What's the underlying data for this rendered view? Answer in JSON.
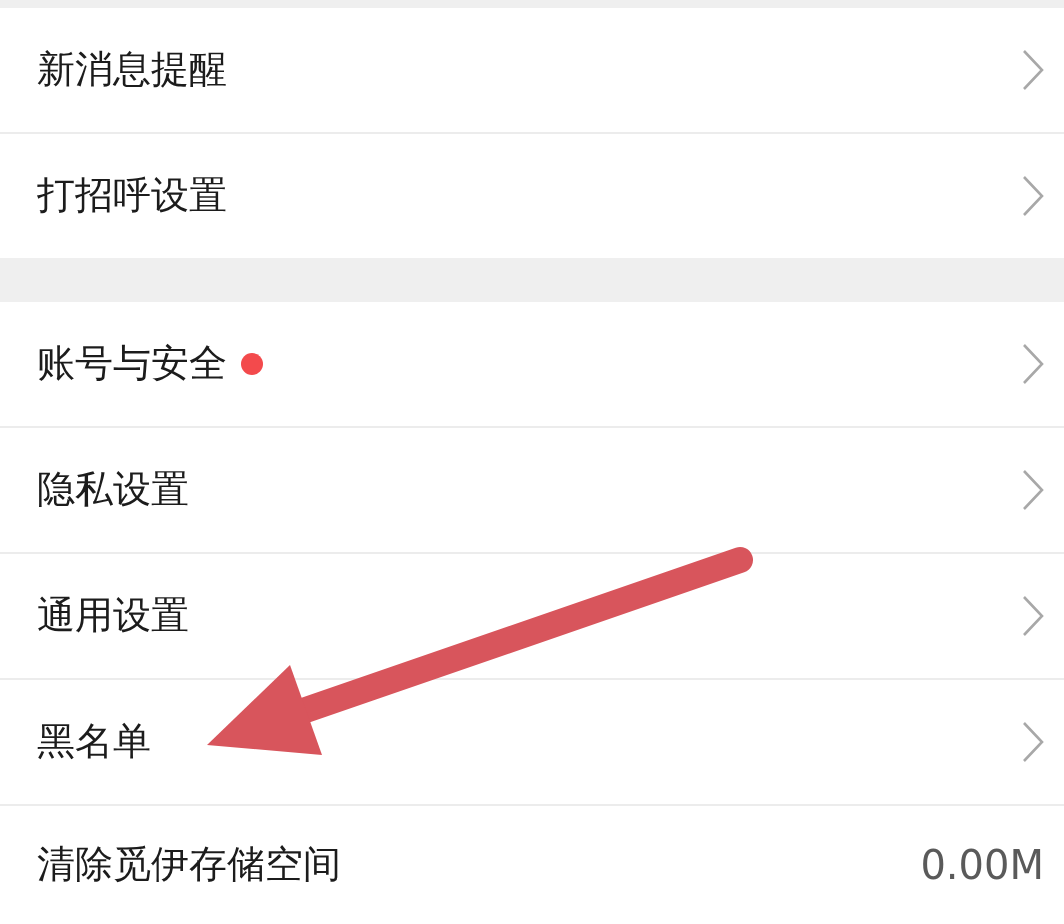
{
  "sections": [
    {
      "items": [
        {
          "kind": "link",
          "label": "新消息提醒",
          "dot": false
        },
        {
          "kind": "link",
          "label": "打招呼设置",
          "dot": false
        }
      ]
    },
    {
      "items": [
        {
          "kind": "link",
          "label": "账号与安全",
          "dot": true
        },
        {
          "kind": "link",
          "label": "隐私设置",
          "dot": false
        },
        {
          "kind": "link",
          "label": "通用设置",
          "dot": false
        },
        {
          "kind": "link",
          "label": "黑名单",
          "dot": false
        },
        {
          "kind": "value",
          "label": "清除觅伊存储空间",
          "dot": false,
          "value": "0.00M"
        }
      ]
    }
  ],
  "annotations": [
    {
      "kind": "arrow"
    }
  ]
}
